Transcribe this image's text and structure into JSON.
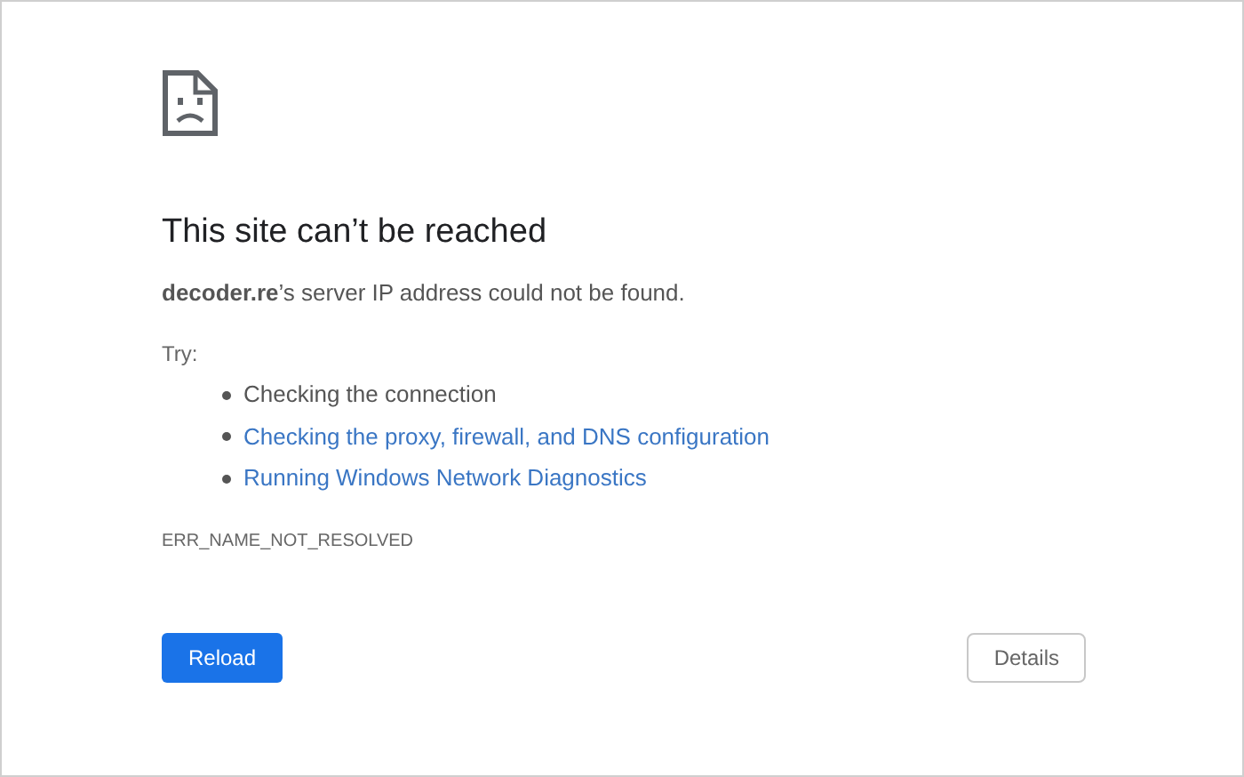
{
  "error": {
    "title": "This site can’t be reached",
    "message": "**decoder.re**’s server IP address could not be found.",
    "try_label": "Try:",
    "suggestions": [
      {
        "kind": "text",
        "label": "Checking the connection"
      },
      {
        "kind": "link",
        "label": "Checking the proxy, firewall, and DNS configuration"
      },
      {
        "kind": "link",
        "label": "Running Windows Network Diagnostics"
      }
    ],
    "code": "ERR_NAME_NOT_RESOLVED"
  },
  "buttons": [
    {
      "kind": "primary",
      "label": "Reload"
    },
    {
      "kind": "secondary",
      "label": "Details"
    }
  ]
}
